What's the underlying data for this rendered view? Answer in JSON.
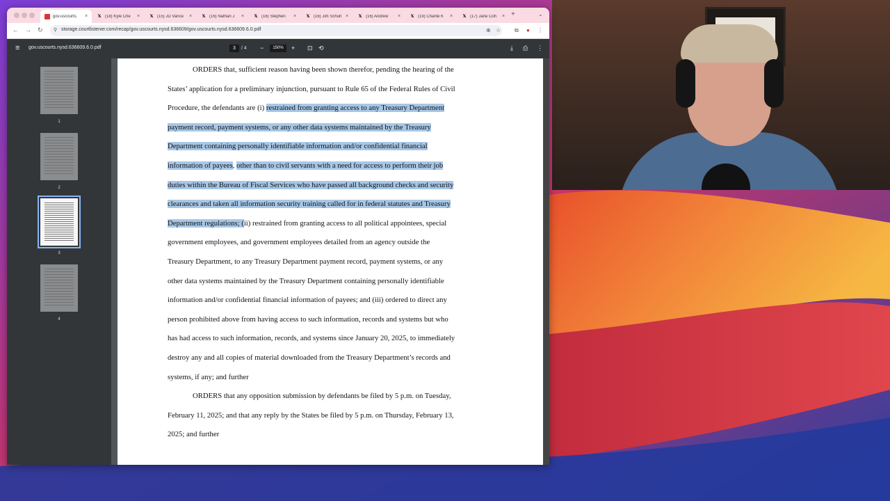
{
  "browser": {
    "tabs": [
      {
        "title": "gov.uscourts.",
        "icon": "pdf",
        "active": true
      },
      {
        "title": "(18) Kyle Che",
        "icon": "x"
      },
      {
        "title": "(15) JD Vance",
        "icon": "x"
      },
      {
        "title": "(16) Nathan J",
        "icon": "x"
      },
      {
        "title": "(16) Stephen",
        "icon": "x"
      },
      {
        "title": "(16) Jim Schult",
        "icon": "x"
      },
      {
        "title": "(16) Andrew",
        "icon": "x"
      },
      {
        "title": "(19) Charlie K",
        "icon": "x"
      },
      {
        "title": "(17) Jane Coh",
        "icon": "x"
      }
    ],
    "url": "storage.courtlistener.com/recap/gov.uscourts.nysd.636609/gov.uscourts.nysd.636609.6.0.pdf"
  },
  "pdf": {
    "filename": "gov.uscourts.nysd.636609.6.0.pdf",
    "page_current": "3",
    "page_total": "4",
    "zoom": "150%",
    "thumbnails": [
      "1",
      "2",
      "3",
      "4"
    ],
    "selected_page": "3",
    "lines": [
      {
        "indent": true,
        "segs": [
          {
            "t": "ORDERS that, sufficient reason having been shown therefor, pending the hearing of the"
          }
        ]
      },
      {
        "segs": [
          {
            "t": "States’ application for a preliminary injunction, pursuant to Rule 65 of the Federal Rules of Civil"
          }
        ]
      },
      {
        "segs": [
          {
            "t": "Procedure, the defendants are (i) "
          },
          {
            "t": "restrained from granting access to any Treasury Department",
            "hl": true
          }
        ]
      },
      {
        "segs": [
          {
            "t": "payment record, payment systems, or any other data systems maintained by the Treasury",
            "hl": true
          }
        ]
      },
      {
        "segs": [
          {
            "t": "Department containing personally identifiable information and/or confidential financial",
            "hl": true
          }
        ]
      },
      {
        "segs": [
          {
            "t": "information of payees",
            "hl": true
          },
          {
            "t": ", "
          },
          {
            "t": "other than to civil servants with a need for access to perform their job",
            "hl": true
          }
        ]
      },
      {
        "segs": [
          {
            "t": "duties within the Bureau of Fiscal Services who have passed all background checks and security",
            "hl": true
          }
        ]
      },
      {
        "segs": [
          {
            "t": "clearances and taken all information security training called for in federal statutes and Treasury",
            "hl": true
          }
        ]
      },
      {
        "segs": [
          {
            "t": "Department regulations; (",
            "hl": true
          },
          {
            "t": "ii) restrained from granting access to all political appointees, special"
          }
        ]
      },
      {
        "segs": [
          {
            "t": "government employees, and government employees detailed from an agency outside the"
          }
        ]
      },
      {
        "segs": [
          {
            "t": "Treasury Department, to any Treasury Department payment record, payment systems, or any"
          }
        ]
      },
      {
        "segs": [
          {
            "t": "other data systems maintained by the Treasury Department containing personally identifiable"
          }
        ]
      },
      {
        "segs": [
          {
            "t": "information and/or confidential financial information of payees; and (iii) ordered to direct any"
          }
        ]
      },
      {
        "segs": [
          {
            "t": "person prohibited above from having access to such information, records and systems but who"
          }
        ]
      },
      {
        "segs": [
          {
            "t": "has had access to such information, records, and systems since January 20, 2025, to immediately"
          }
        ]
      },
      {
        "segs": [
          {
            "t": "destroy any and all copies of material downloaded from the Treasury Department’s records and"
          }
        ]
      },
      {
        "segs": [
          {
            "t": "systems, if any; and further"
          }
        ]
      },
      {
        "indent": true,
        "segs": [
          {
            "t": "ORDERS that any opposition submission by defendants be filed by 5 p.m. on Tuesday,"
          }
        ]
      },
      {
        "segs": [
          {
            "t": "February 11, 2025; and that any reply by the States be filed by 5 p.m. on Thursday, February 13,"
          }
        ]
      },
      {
        "segs": [
          {
            "t": "2025; and further"
          }
        ]
      }
    ]
  },
  "colors": {
    "highlight": "#a7c7e7",
    "tabstrip": "#fadbe3",
    "viewer_bg": "#525659"
  }
}
